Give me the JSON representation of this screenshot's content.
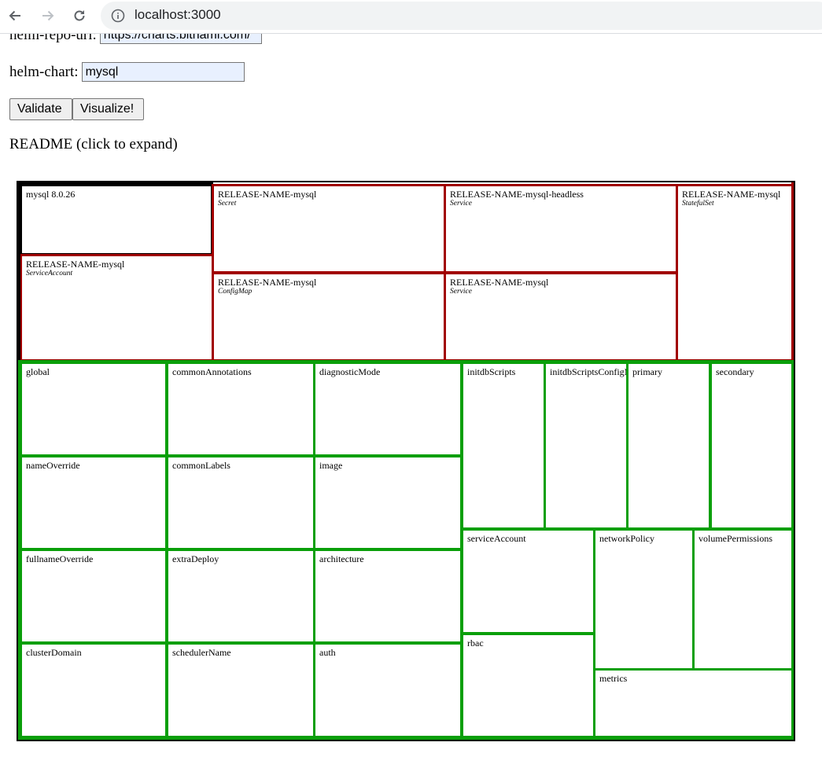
{
  "browser": {
    "url": "localhost:3000",
    "icons": [
      "back-arrow-icon",
      "forward-arrow-icon",
      "reload-icon",
      "info-icon"
    ]
  },
  "form": {
    "repo_label": "helm-repo-url:",
    "repo_value": "https://charts.bitnami.com/",
    "chart_label": "helm-chart:",
    "chart_value": "mysql",
    "validate_label": "Validate",
    "visualize_label": "Visualize!",
    "readme_label": "README (click to expand)"
  },
  "colors": {
    "resource_border": "#a10000",
    "values_border": "#0a9f0a",
    "chart_border": "#000000"
  },
  "treemap": {
    "chart": {
      "name": "mysql 8.0.26"
    },
    "resources": [
      {
        "name": "RELEASE-NAME-mysql",
        "kind": "ServiceAccount"
      },
      {
        "name": "RELEASE-NAME-mysql",
        "kind": "Secret"
      },
      {
        "name": "RELEASE-NAME-mysql",
        "kind": "ConfigMap"
      },
      {
        "name": "RELEASE-NAME-mysql-headless",
        "kind": "Service"
      },
      {
        "name": "RELEASE-NAME-mysql",
        "kind": "Service"
      },
      {
        "name": "RELEASE-NAME-mysql",
        "kind": "StatefulSet"
      }
    ],
    "values": [
      "global",
      "nameOverride",
      "fullnameOverride",
      "clusterDomain",
      "commonAnnotations",
      "commonLabels",
      "extraDeploy",
      "schedulerName",
      "diagnosticMode",
      "image",
      "architecture",
      "auth",
      "initdbScripts",
      "initdbScriptsConfigMap",
      "primary",
      "secondary",
      "serviceAccount",
      "rbac",
      "networkPolicy",
      "volumePermissions",
      "metrics"
    ]
  }
}
